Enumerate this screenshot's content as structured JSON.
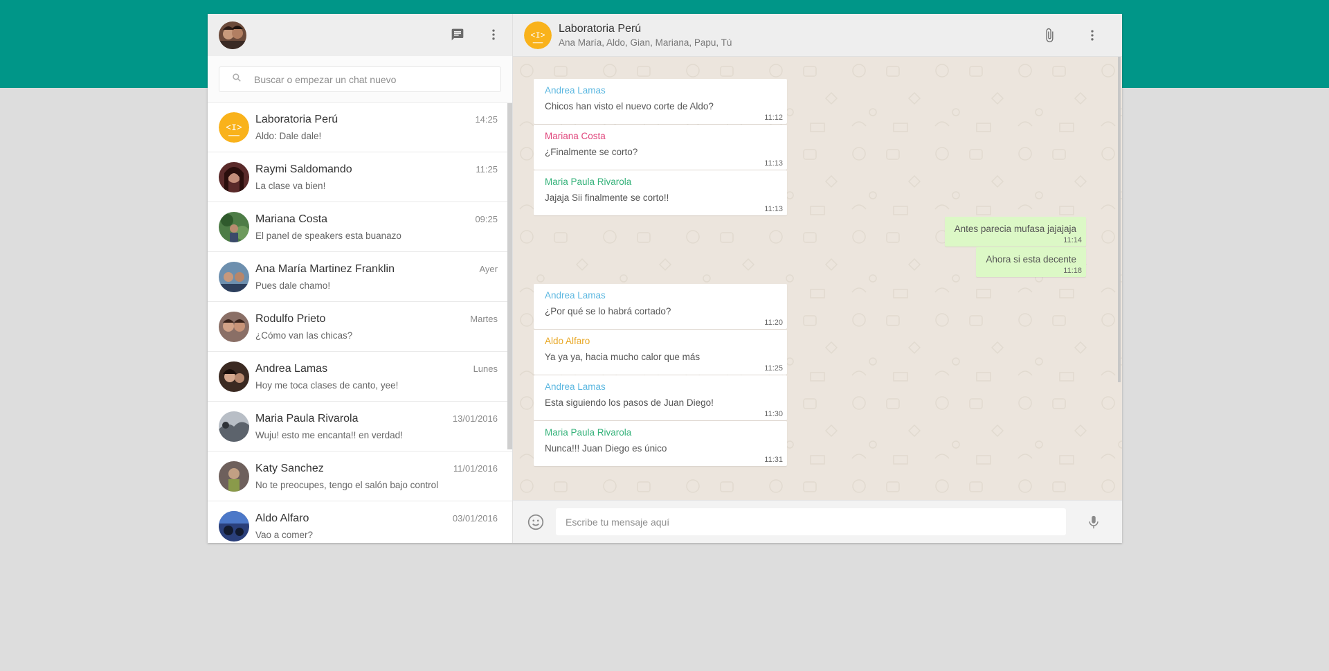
{
  "header": {
    "new_chat_icon": "chat-bubble-icon",
    "menu_icon": "more-vert-icon"
  },
  "search": {
    "placeholder": "Buscar o empezar un chat nuevo"
  },
  "chats": [
    {
      "name": "Laboratoria Perú",
      "time": "14:25",
      "preview": "Aldo: Dale dale!",
      "avatar": "laboratoria-logo",
      "color": "#f9b21b"
    },
    {
      "name": "Raymi Saldomando",
      "time": "11:25",
      "preview": "La clase va bien!",
      "color": "#5a2a2a"
    },
    {
      "name": "Mariana Costa",
      "time": "09:25",
      "preview": "El panel de speakers esta buanazo",
      "color": "#3e6b3a"
    },
    {
      "name": "Ana María Martinez Franklin",
      "time": "Ayer",
      "preview": "Pues dale chamo!",
      "color": "#4a6d8c"
    },
    {
      "name": "Rodulfo Prieto",
      "time": "Martes",
      "preview": "¿Cómo van las chicas?",
      "color": "#7c5a55"
    },
    {
      "name": "Andrea Lamas",
      "time": "Lunes",
      "preview": "Hoy me toca clases de canto, yee!",
      "color": "#3b2a22"
    },
    {
      "name": "Maria Paula Rivarola",
      "time": "13/01/2016",
      "preview": "Wuju! esto me encanta!! en verdad!",
      "color": "#8a8f97"
    },
    {
      "name": "Katy Sanchez",
      "time": "11/01/2016",
      "preview": "No te preocupes, tengo el salón bajo control",
      "color": "#5b4d4a"
    },
    {
      "name": "Aldo Alfaro",
      "time": "03/01/2016",
      "preview": "Vao a comer?",
      "color": "#1f2e5a"
    }
  ],
  "conversation": {
    "name": "Laboratoria Perú",
    "members": "Ana María, Aldo, Gian, Mariana, Papu, Tú",
    "attach_icon": "paperclip-icon",
    "menu_icon": "more-vert-icon"
  },
  "messages": [
    {
      "type": "in",
      "sender": "Andrea Lamas",
      "sender_color": "#5bb7e0",
      "text": "Chicos han visto el nuevo corte de Aldo?",
      "time": "11:12"
    },
    {
      "type": "in",
      "sender": "Mariana Costa",
      "sender_color": "#e0457b",
      "text": "¿Finalmente se corto?",
      "time": "11:13"
    },
    {
      "type": "in",
      "sender": "Maria Paula Rivarola",
      "sender_color": "#35b27a",
      "text": "Jajaja Sii finalmente se corto!!",
      "time": "11:13"
    },
    {
      "type": "out",
      "text": "Antes parecia mufasa jajajaja",
      "time": "11:14"
    },
    {
      "type": "out",
      "text": "Ahora si esta decente",
      "time": "11:18"
    },
    {
      "type": "in",
      "sender": "Andrea Lamas",
      "sender_color": "#5bb7e0",
      "text": "¿Por qué se lo habrá cortado?",
      "time": "11:20"
    },
    {
      "type": "in",
      "sender": "Aldo Alfaro",
      "sender_color": "#e8a724",
      "text": "Ya ya ya, hacia mucho calor que más",
      "time": "11:25"
    },
    {
      "type": "in",
      "sender": "Andrea Lamas",
      "sender_color": "#5bb7e0",
      "text": "Esta siguiendo los pasos de Juan Diego!",
      "time": "11:30"
    },
    {
      "type": "in",
      "sender": "Maria Paula Rivarola",
      "sender_color": "#35b27a",
      "text": "Nunca!!! Juan Diego es único",
      "time": "11:31"
    }
  ],
  "composer": {
    "placeholder": "Escribe tu mensaje aquí",
    "emoji_icon": "smiley-icon",
    "mic_icon": "microphone-icon"
  },
  "theme": {
    "accent": "#009688",
    "outgoing": "#dcf8c6",
    "background": "#ece5dd"
  }
}
